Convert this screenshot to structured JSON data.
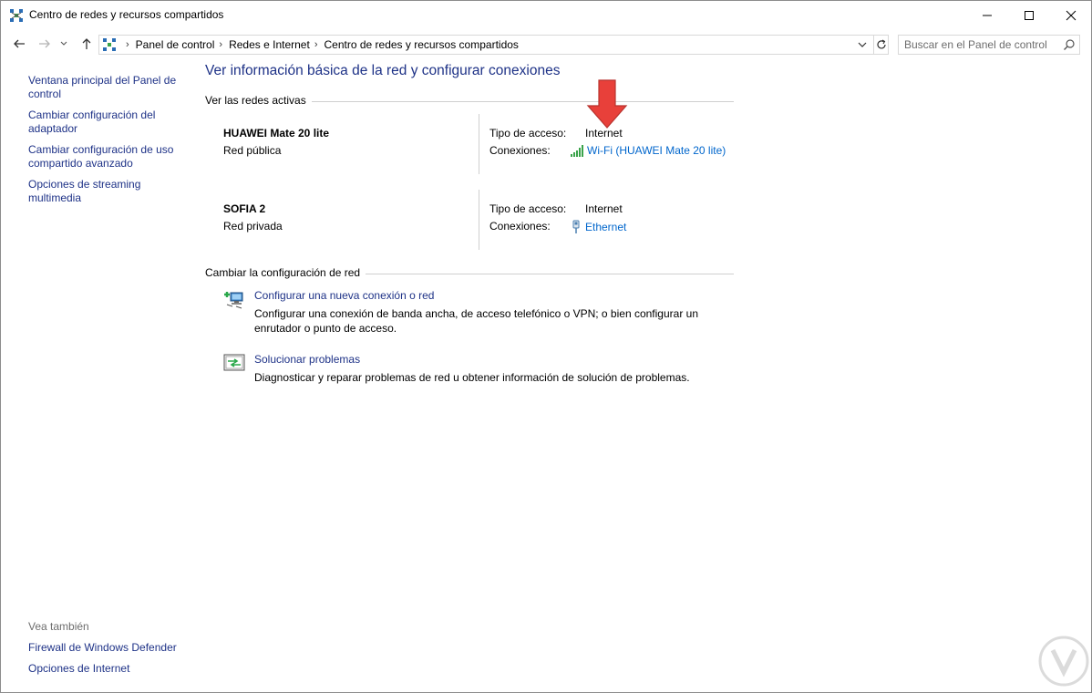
{
  "window": {
    "title": "Centro de redes y recursos compartidos",
    "controls": {
      "minimize": "minimize-icon",
      "maximize": "maximize-icon",
      "close": "close-icon"
    }
  },
  "nav": {
    "breadcrumbs": [
      "Panel de control",
      "Redes e Internet",
      "Centro de redes y recursos compartidos"
    ],
    "search_placeholder": "Buscar en el Panel de control"
  },
  "sidebar": {
    "links": [
      "Ventana principal del Panel de control",
      "Cambiar configuración del adaptador",
      "Cambiar configuración de uso compartido avanzado",
      "Opciones de streaming multimedia"
    ],
    "see_also_header": "Vea también",
    "see_also_links": [
      "Firewall de Windows Defender",
      "Opciones de Internet"
    ]
  },
  "main": {
    "heading": "Ver información básica de la red y configurar conexiones",
    "active_networks_header": "Ver las redes activas",
    "networks": [
      {
        "name": "HUAWEI Mate 20 lite",
        "type": "Red pública",
        "access_label": "Tipo de acceso:",
        "access_value": "Internet",
        "connections_label": "Conexiones:",
        "connection": "Wi-Fi (HUAWEI Mate 20 lite)",
        "connection_icon": "wifi-signal-icon"
      },
      {
        "name": "SOFIA 2",
        "type": "Red privada",
        "access_label": "Tipo de acceso:",
        "access_value": "Internet",
        "connections_label": "Conexiones:",
        "connection": "Ethernet",
        "connection_icon": "ethernet-plug-icon"
      }
    ],
    "change_settings_header": "Cambiar la configuración de red",
    "tasks": [
      {
        "link": "Configurar una nueva conexión o red",
        "description": "Configurar una conexión de banda ancha, de acceso telefónico o VPN; o bien configurar un enrutador o punto de acceso.",
        "icon": "new-connection-icon"
      },
      {
        "link": "Solucionar problemas",
        "description": "Diagnosticar y reparar problemas de red u obtener información de solución de problemas.",
        "icon": "troubleshoot-icon"
      }
    ]
  },
  "colors": {
    "link": "#1e3287",
    "connection_link": "#0066cc",
    "annotation_arrow": "#e8403a"
  }
}
